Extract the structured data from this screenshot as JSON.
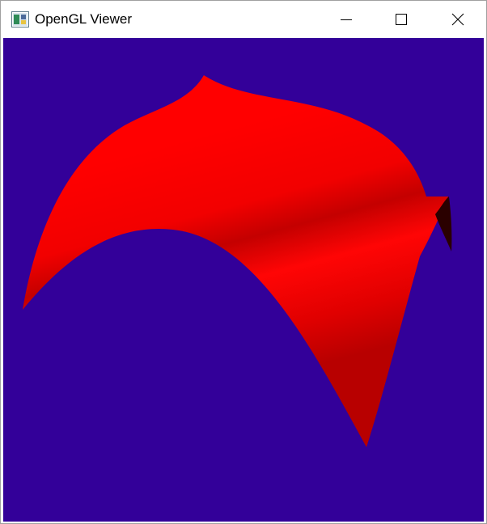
{
  "window": {
    "title": "OpenGL Viewer",
    "app_icon": "opengl-app-icon",
    "controls": {
      "minimize_icon": "minimize-icon",
      "maximize_icon": "maximize-icon",
      "close_icon": "close-icon"
    }
  },
  "viewport": {
    "background_color": "#330099",
    "surface_color": "#ff0000",
    "surface_shade_color": "#c00000",
    "surface_backface_color": "#2a0000"
  }
}
